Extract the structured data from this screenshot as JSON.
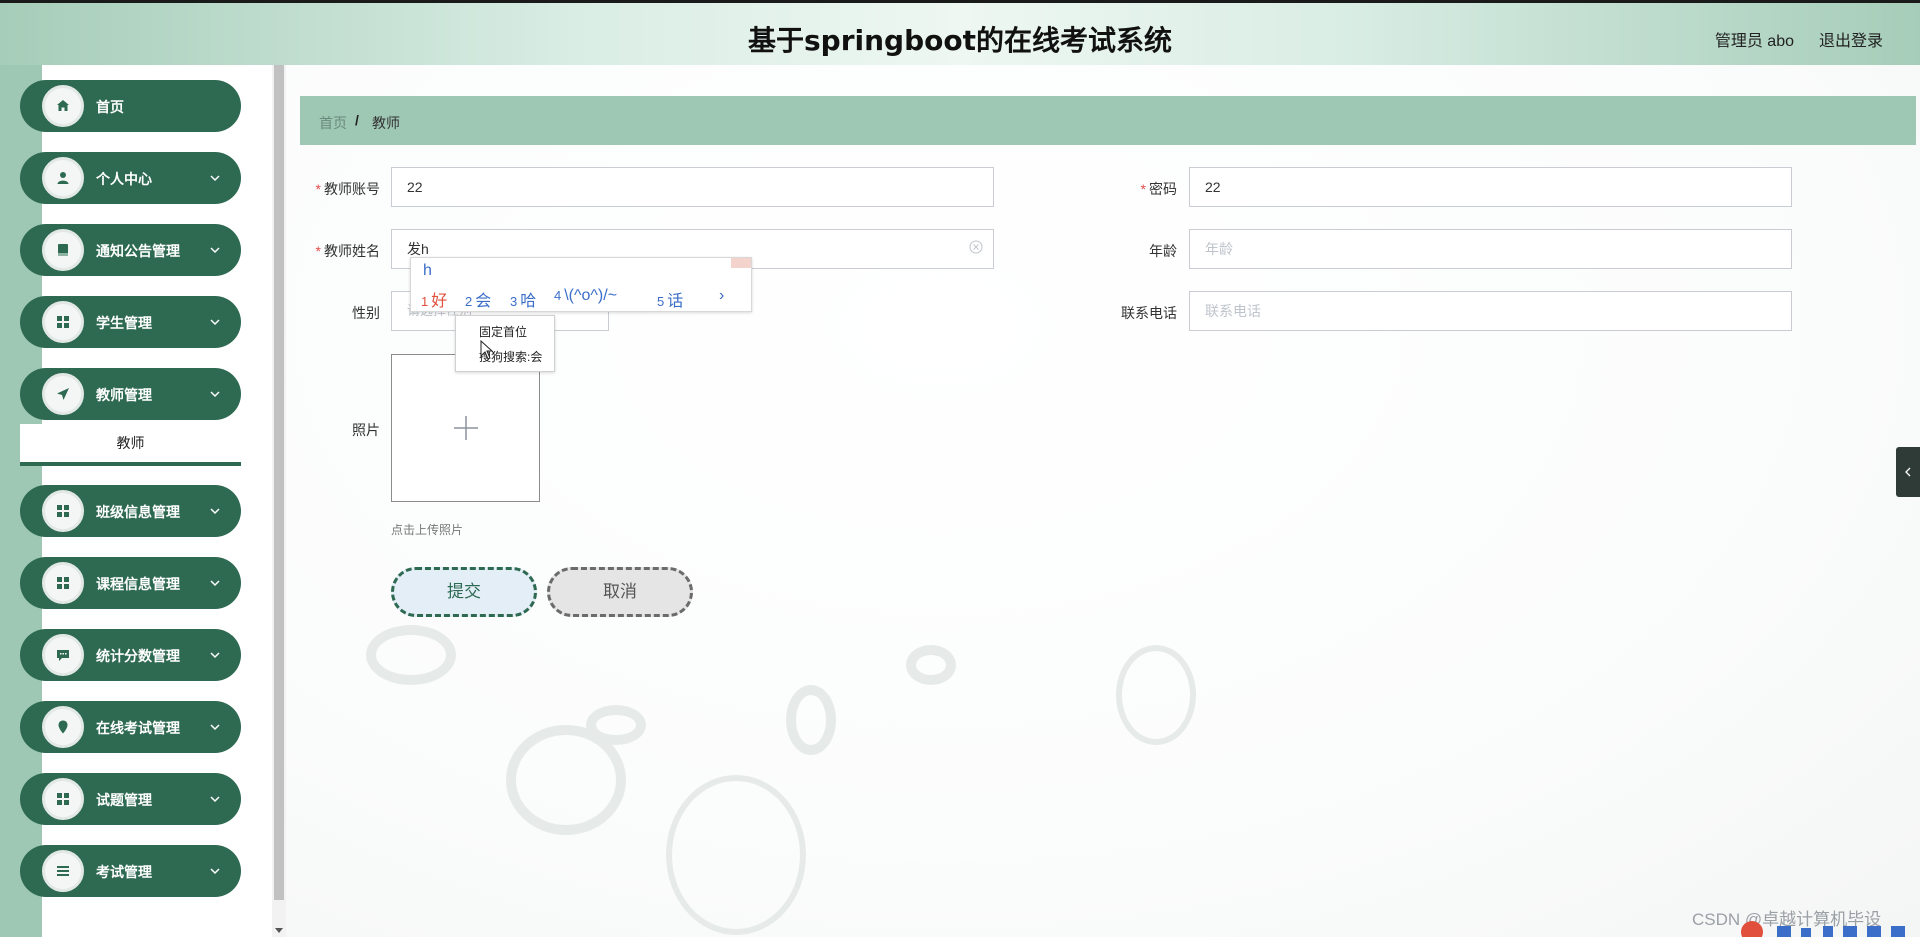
{
  "header": {
    "title": "基于springboot的在线考试系统",
    "user": "管理员 abo",
    "logout": "退出登录"
  },
  "sidebar": {
    "items": [
      {
        "label": "首页",
        "icon": "home-icon"
      },
      {
        "label": "个人中心",
        "icon": "user-icon"
      },
      {
        "label": "通知公告管理",
        "icon": "book-icon"
      },
      {
        "label": "学生管理",
        "icon": "grid-icon"
      },
      {
        "label": "教师管理",
        "icon": "send-icon"
      },
      {
        "label": "班级信息管理",
        "icon": "grid-icon"
      },
      {
        "label": "课程信息管理",
        "icon": "grid-icon"
      },
      {
        "label": "统计分数管理",
        "icon": "chat-icon"
      },
      {
        "label": "在线考试管理",
        "icon": "location-icon"
      },
      {
        "label": "试题管理",
        "icon": "grid-icon"
      },
      {
        "label": "考试管理",
        "icon": "list-icon"
      }
    ],
    "sub_active": "教师"
  },
  "breadcrumb": {
    "home": "首页",
    "separator": "/",
    "current": "教师"
  },
  "form": {
    "account_label": "教师账号",
    "account_value": "22",
    "password_label": "密码",
    "password_value": "22",
    "name_label": "教师姓名",
    "name_value": "发h",
    "age_label": "年龄",
    "age_placeholder": "年龄",
    "gender_label": "性别",
    "gender_placeholder": "请选择性别",
    "phone_label": "联系电话",
    "phone_placeholder": "联系电话",
    "photo_label": "照片",
    "upload_tip": "点击上传照片",
    "submit": "提交",
    "cancel": "取消"
  },
  "ime": {
    "pinyin": "h",
    "candidates": [
      {
        "n": "1",
        "text": "好"
      },
      {
        "n": "2",
        "text": "会"
      },
      {
        "n": "3",
        "text": "哈"
      },
      {
        "n": "4",
        "text": "\\(^o^)/~"
      },
      {
        "n": "5",
        "text": "话"
      }
    ],
    "next": "›",
    "menu": [
      "固定首位",
      "搜狗搜索:会"
    ]
  },
  "watermark": "CSDN @卓越计算机毕设",
  "colors": {
    "primary": "#2e6a52",
    "header_bg": "#d9ede4",
    "breadcrumb_bg": "#9ec7b4",
    "required": "#e34b4b"
  }
}
